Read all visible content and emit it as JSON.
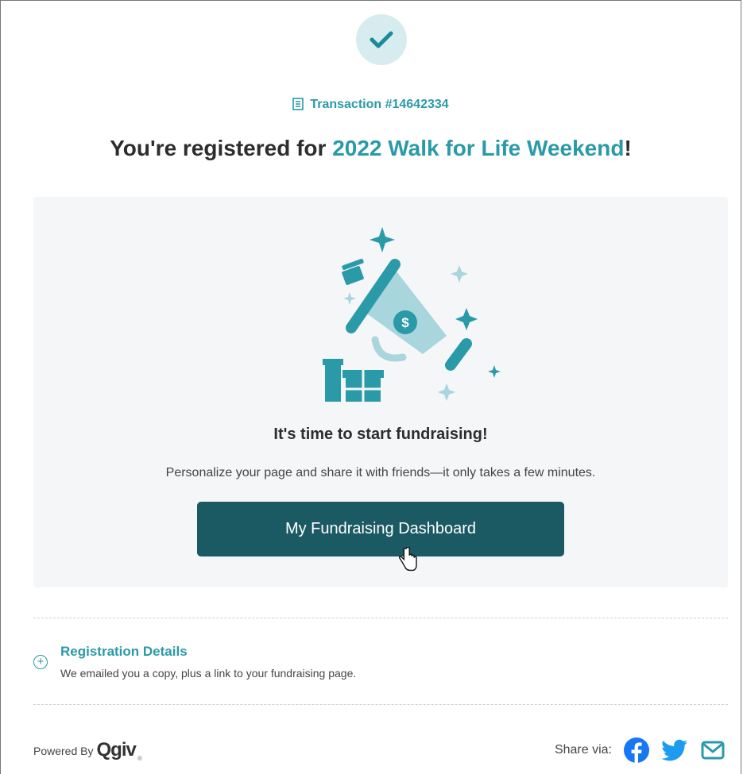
{
  "header": {
    "transaction": "Transaction #14642334",
    "headline_prefix": "You're registered for ",
    "event_name": "2022 Walk for Life Weekend",
    "headline_suffix": "!"
  },
  "panel": {
    "title": "It's time to start fundraising!",
    "subtitle": "Personalize your page and share it with friends—it only takes a few minutes.",
    "button_label": "My Fundraising Dashboard"
  },
  "registration": {
    "title": "Registration Details",
    "subtitle": "We emailed you a copy, plus a link to your fundraising page."
  },
  "footer": {
    "powered_by": "Powered By",
    "logo_text": "Qgiv",
    "share_label": "Share via:",
    "share_icons": [
      "facebook-icon",
      "twitter-icon",
      "email-icon"
    ]
  },
  "colors": {
    "accent": "#2a9aa8",
    "button": "#1b5a62",
    "panel_bg": "#f4f6f8",
    "facebook": "#1877f2",
    "twitter": "#1d9bf0"
  }
}
